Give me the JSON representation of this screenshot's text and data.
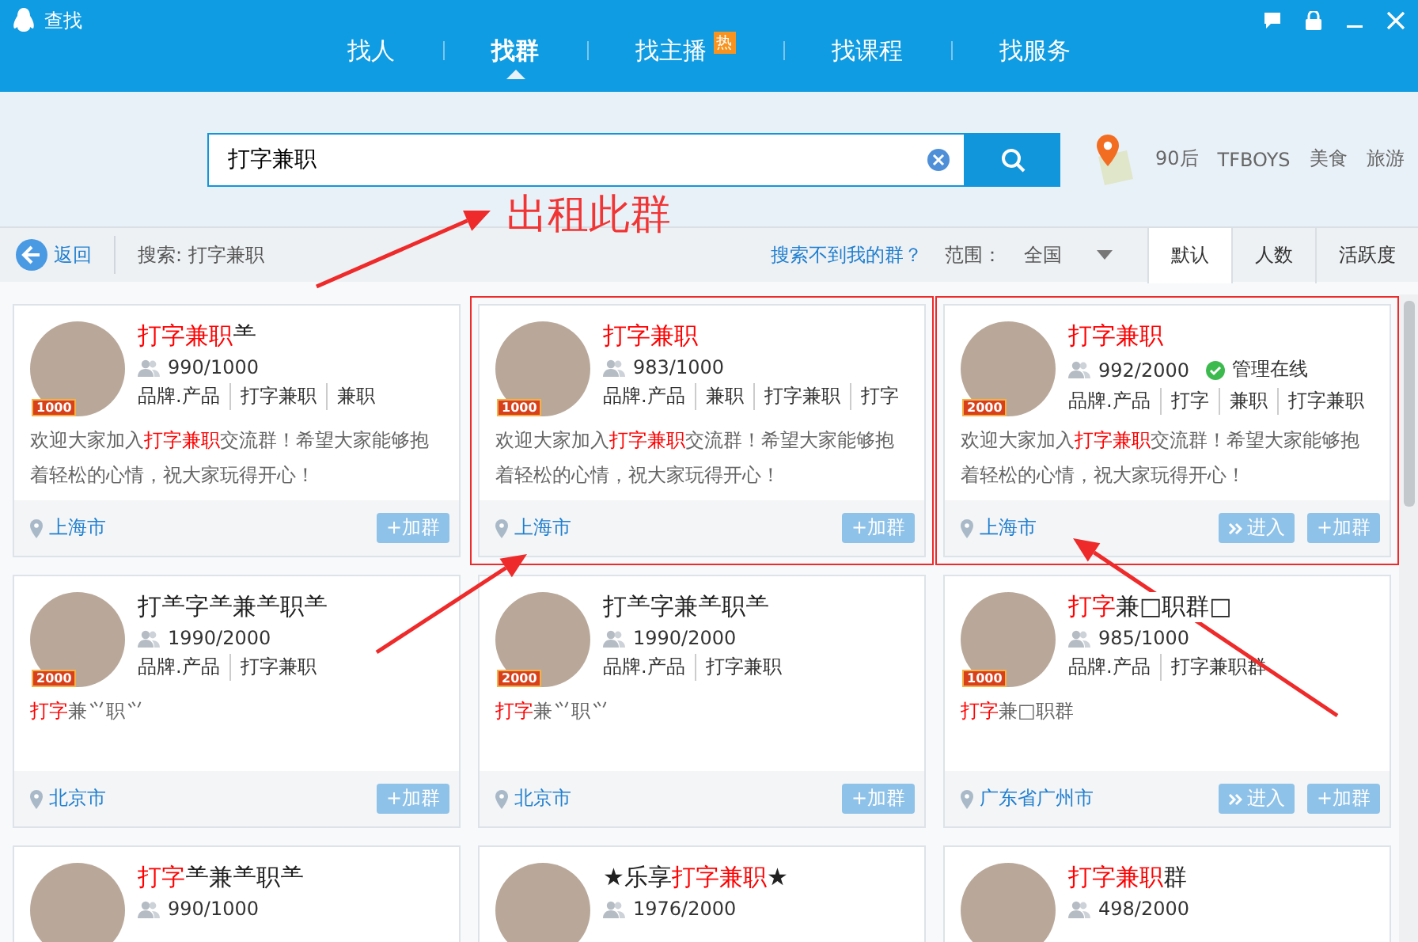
{
  "window": {
    "title": "查找"
  },
  "tabs": [
    {
      "label": "找人",
      "selected": false
    },
    {
      "label": "找群",
      "selected": true
    },
    {
      "label": "找主播",
      "selected": false,
      "badge": "热"
    },
    {
      "label": "找课程",
      "selected": false
    },
    {
      "label": "找服务",
      "selected": false
    }
  ],
  "search": {
    "value": "打字兼职"
  },
  "hot_tags": [
    "90后",
    "TFBOYS",
    "美食",
    "旅游"
  ],
  "toolbar": {
    "back": "返回",
    "query": "搜索: 打字兼职",
    "help_link": "搜索不到我的群？",
    "scope_label": "范围：",
    "scope": "全国",
    "sorts": [
      {
        "label": "默认",
        "selected": true
      },
      {
        "label": "人数",
        "selected": false
      },
      {
        "label": "活跃度",
        "selected": false
      }
    ]
  },
  "annotation": {
    "text": "出租此群"
  },
  "cards": [
    {
      "outlined": false,
      "badge": "1000",
      "name": [
        {
          "text": "打字兼职",
          "hl": true
        },
        {
          "text": "⺷",
          "hl": false
        }
      ],
      "members": "990/1000",
      "tags": [
        "品牌.产品",
        "打字兼职",
        "兼职"
      ],
      "desc": [
        {
          "text": "欢迎大家加入",
          "hl": false
        },
        {
          "text": "打字兼职",
          "hl": true
        },
        {
          "text": "交流群！希望大家能够抱着轻松的心情，祝大家玩得开心！",
          "hl": false
        }
      ],
      "location": "上海市",
      "buttons": [
        {
          "kind": "join",
          "label": "+加群"
        }
      ]
    },
    {
      "outlined": true,
      "badge": "1000",
      "name": [
        {
          "text": "打字兼职",
          "hl": true
        }
      ],
      "members": "983/1000",
      "tags": [
        "品牌.产品",
        "兼职",
        "打字兼职",
        "打字"
      ],
      "desc": [
        {
          "text": "欢迎大家加入",
          "hl": false
        },
        {
          "text": "打字兼职",
          "hl": true
        },
        {
          "text": "交流群！希望大家能够抱着轻松的心情，祝大家玩得开心！",
          "hl": false
        }
      ],
      "location": "上海市",
      "buttons": [
        {
          "kind": "join",
          "label": "+加群"
        }
      ]
    },
    {
      "outlined": true,
      "badge": "2000",
      "name": [
        {
          "text": "打字兼职",
          "hl": true
        }
      ],
      "members": "992/2000",
      "admin": "管理在线",
      "tags": [
        "品牌.产品",
        "打字",
        "兼职",
        "打字兼职"
      ],
      "desc": [
        {
          "text": "欢迎大家加入",
          "hl": false
        },
        {
          "text": "打字兼职",
          "hl": true
        },
        {
          "text": "交流群！希望大家能够抱着轻松的心情，祝大家玩得开心！",
          "hl": false
        }
      ],
      "location": "上海市",
      "buttons": [
        {
          "kind": "enter",
          "label": "进入"
        },
        {
          "kind": "join",
          "label": "+加群"
        }
      ]
    },
    {
      "outlined": false,
      "badge": "2000",
      "name": [
        {
          "text": "打⺷字⺷兼⺷职⺷",
          "hl": false
        }
      ],
      "members": "1990/2000",
      "tags": [
        "品牌.产品",
        "打字兼职"
      ],
      "desc": [
        {
          "text": "打字",
          "hl": true
        },
        {
          "text": "兼⺍职⺍",
          "hl": false
        }
      ],
      "location": "北京市",
      "buttons": [
        {
          "kind": "join",
          "label": "+加群"
        }
      ]
    },
    {
      "outlined": false,
      "badge": "2000",
      "name": [
        {
          "text": "打⺷字兼⺷职⺷",
          "hl": false
        }
      ],
      "members": "1990/2000",
      "tags": [
        "品牌.产品",
        "打字兼职"
      ],
      "desc": [
        {
          "text": "打字",
          "hl": true
        },
        {
          "text": "兼⺍职⺍",
          "hl": false
        }
      ],
      "location": "北京市",
      "buttons": [
        {
          "kind": "join",
          "label": "+加群"
        }
      ]
    },
    {
      "outlined": false,
      "badge": "1000",
      "name": [
        {
          "text": "打字",
          "hl": true
        },
        {
          "text": "兼□职群□",
          "hl": false
        }
      ],
      "members": "985/1000",
      "tags": [
        "品牌.产品",
        "打字兼职群"
      ],
      "desc": [
        {
          "text": "打字",
          "hl": true
        },
        {
          "text": "兼□职群",
          "hl": false
        }
      ],
      "location": "广东省广州市",
      "buttons": [
        {
          "kind": "enter",
          "label": "进入"
        },
        {
          "kind": "join",
          "label": "+加群"
        }
      ]
    },
    {
      "outlined": false,
      "name": [
        {
          "text": "打字",
          "hl": true
        },
        {
          "text": "⺷兼⺷职⺷",
          "hl": false
        }
      ],
      "members": "990/1000"
    },
    {
      "outlined": false,
      "name": [
        {
          "text": "★乐享",
          "hl": false
        },
        {
          "text": "打字兼职",
          "hl": true
        },
        {
          "text": "★",
          "hl": false
        }
      ],
      "members": "1976/2000"
    },
    {
      "outlined": false,
      "name": [
        {
          "text": "打字兼职",
          "hl": true
        },
        {
          "text": "群",
          "hl": false
        }
      ],
      "members": "498/2000"
    }
  ]
}
